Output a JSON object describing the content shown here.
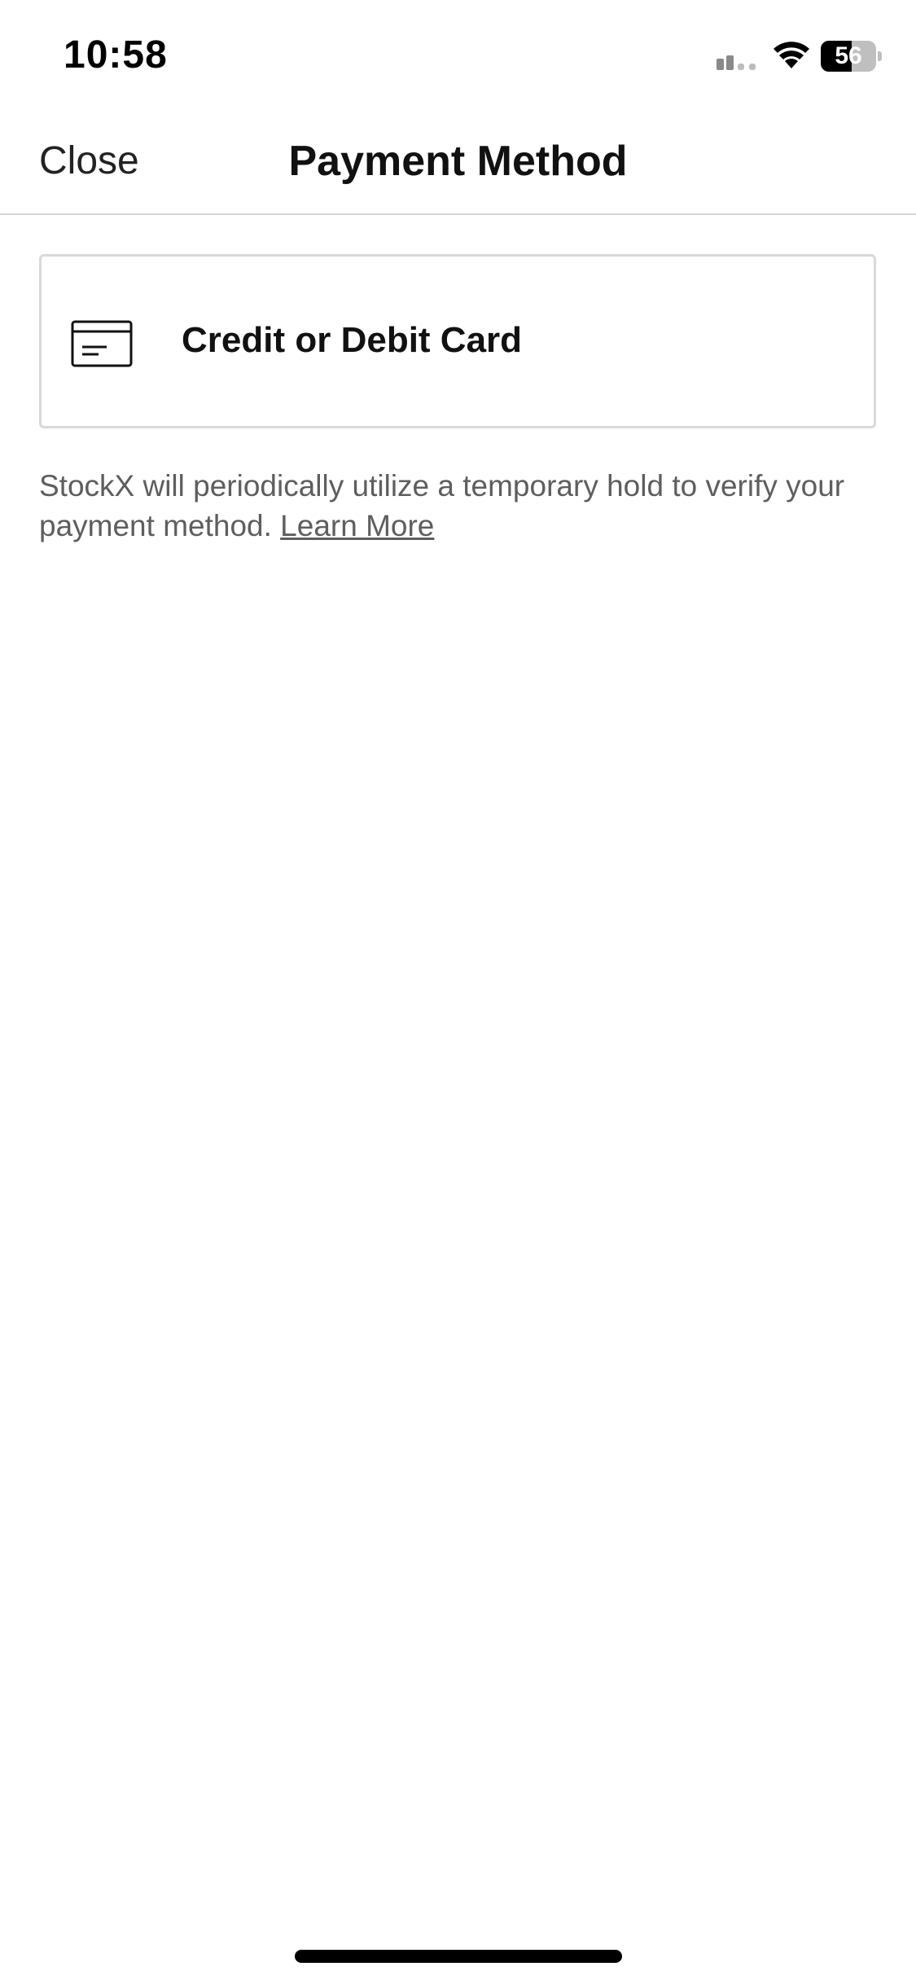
{
  "status_bar": {
    "time": "10:58",
    "battery_level": "56",
    "battery_fraction": 0.56
  },
  "nav": {
    "close_label": "Close",
    "title": "Payment Method"
  },
  "payment_options": [
    {
      "label": "Credit or Debit Card",
      "icon": "credit-card-icon"
    }
  ],
  "note": {
    "text": "StockX will periodically utilize a temporary hold to verify your payment method. ",
    "link_label": "Learn More"
  },
  "colors": {
    "text_primary": "#111111",
    "text_secondary": "#5e5e5e",
    "border": "#d9d9d9",
    "background": "#ffffff"
  }
}
